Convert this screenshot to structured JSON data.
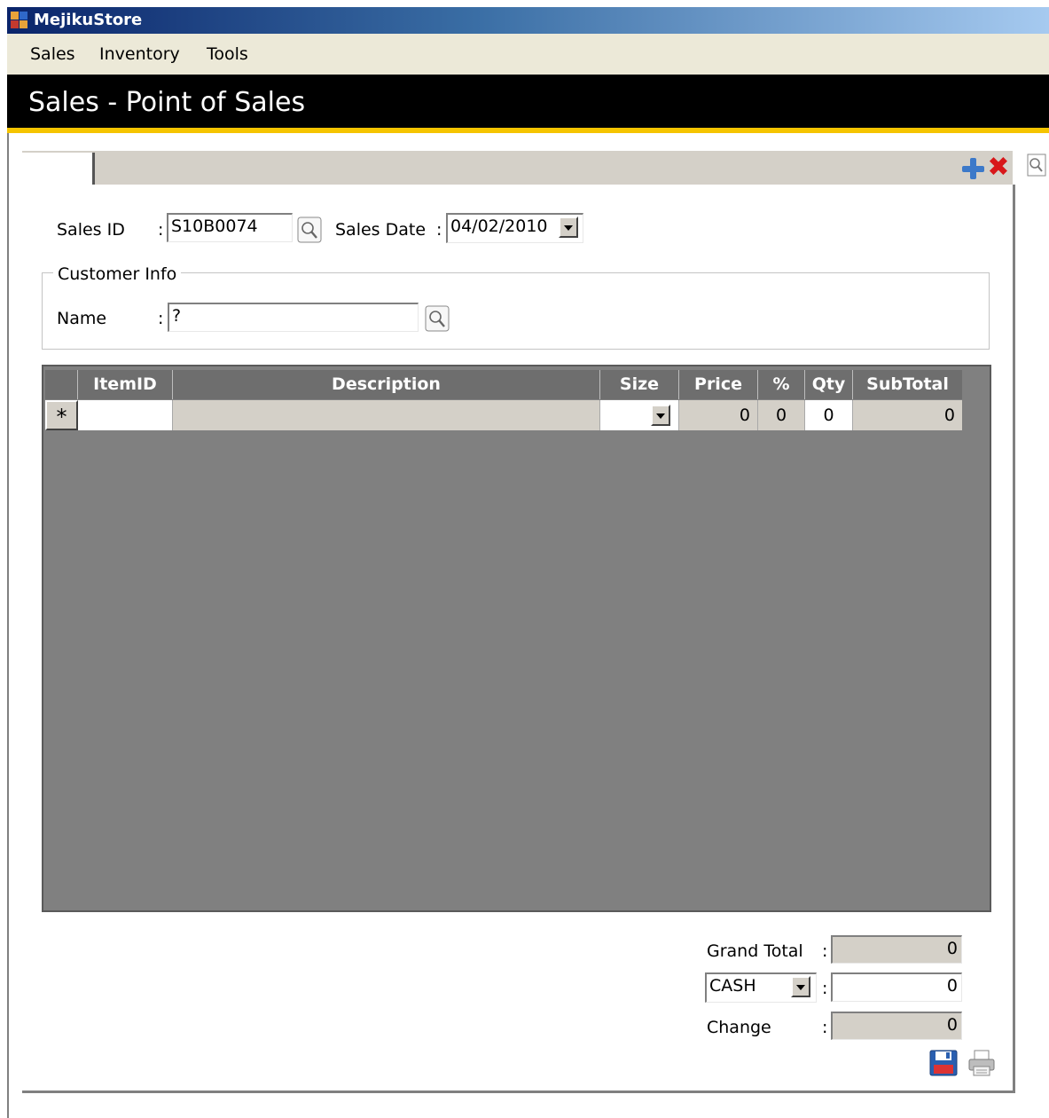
{
  "window": {
    "title": "MejikuStore"
  },
  "menu": [
    "Sales",
    "Inventory",
    "Tools"
  ],
  "header": {
    "title": "Sales - Point of Sales"
  },
  "form": {
    "sales_id_label": "Sales ID",
    "sales_id_value": "S10B0074",
    "sales_date_label": "Sales Date",
    "sales_date_value": "04/02/2010",
    "customer_group_label": "Customer Info",
    "name_label": "Name",
    "name_value": "?",
    "colon": ":"
  },
  "grid": {
    "columns": [
      "ItemID",
      "Description",
      "Size",
      "Price",
      "%",
      "Qty",
      "SubTotal"
    ],
    "new_row": {
      "indicator": "*",
      "item_id": "",
      "description": "",
      "size": "",
      "price": "0",
      "percent": "0",
      "qty": "0",
      "subtotal": "0"
    }
  },
  "totals": {
    "grand_total_label": "Grand Total",
    "grand_total_value": "0",
    "payment_method": "CASH",
    "payment_value": "0",
    "change_label": "Change",
    "change_value": "0"
  },
  "icons": {
    "add": "plus-icon",
    "delete": "x-icon",
    "search": "magnifier-icon",
    "save": "floppy-icon",
    "print": "printer-icon"
  },
  "colors": {
    "header_bg": "#000000",
    "header_stripe": "#f5c400",
    "grid_bg": "#808080",
    "add": "#3c79c9",
    "delete": "#d8171a"
  }
}
